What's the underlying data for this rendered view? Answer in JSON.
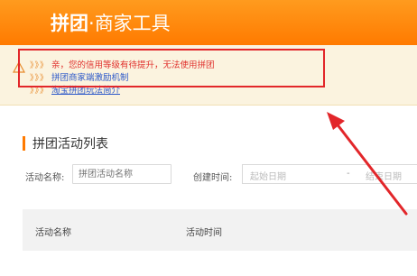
{
  "header": {
    "brand_main": "拼团",
    "brand_dot": "·",
    "brand_sub": "商家工具"
  },
  "notice": {
    "chevrons": "》》》",
    "lines": [
      {
        "text": "亲，您的信用等级有待提升，无法使用拼团"
      },
      {
        "text": "拼团商家端激励机制"
      },
      {
        "text": "淘宝拼团玩法简介"
      }
    ]
  },
  "section": {
    "title": "拼团活动列表"
  },
  "filters": {
    "name_label": "活动名称:",
    "name_placeholder": "拼团活动名称",
    "time_label": "创建时间:",
    "start_placeholder": "起始日期",
    "separator": "-",
    "end_placeholder": "结束日期"
  },
  "table": {
    "columns": [
      "活动名称",
      "活动时间"
    ]
  },
  "colors": {
    "header": "#ff7a00",
    "highlight": "#e2262a",
    "link": "#2c58c9"
  }
}
